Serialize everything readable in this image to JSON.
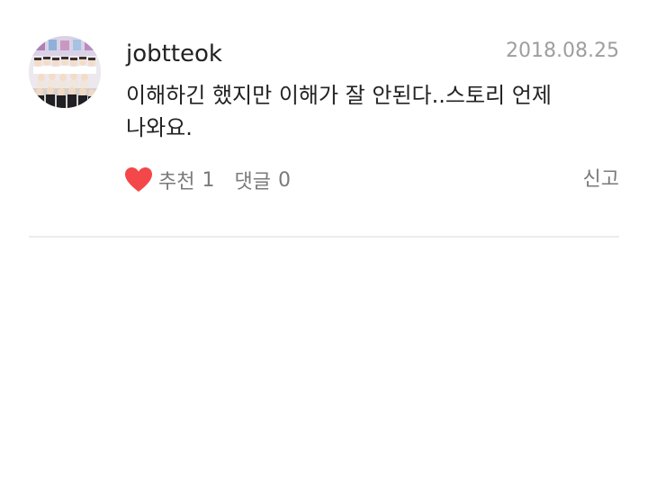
{
  "comment": {
    "username": "jobtteok",
    "date": "2018.08.25",
    "text": "이해하긴 했지만 이해가 잘 안된다..스토리 언제 나와요.",
    "like_label": "추천",
    "like_count": "1",
    "reply_label": "댓글",
    "reply_count": "0",
    "report_label": "신고",
    "heart_color": "#f4474a",
    "avatar_icon": "group-photo-avatar",
    "like_icon": "heart-icon"
  }
}
